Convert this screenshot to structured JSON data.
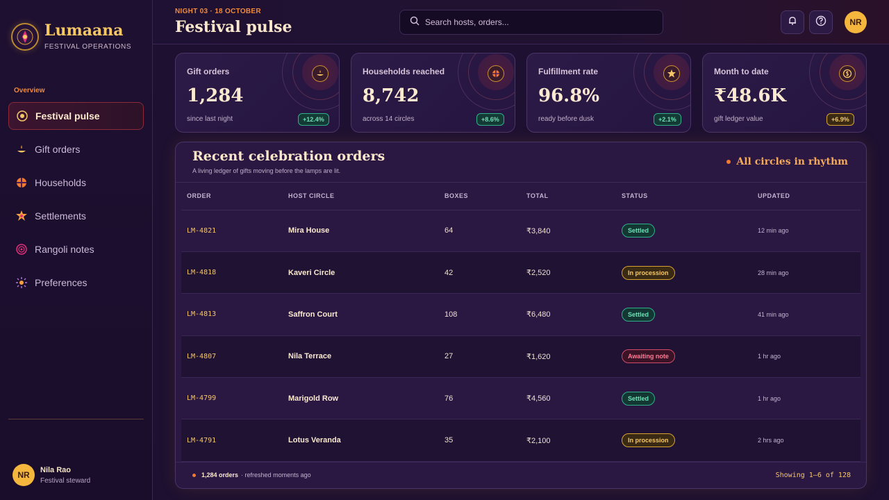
{
  "brand": {
    "name": "Lumaana",
    "subtitle": "FESTIVAL OPERATIONS"
  },
  "sidebar": {
    "section": "Overview",
    "items": [
      {
        "label": "Festival pulse",
        "icon": "pulse-icon",
        "active": true
      },
      {
        "label": "Gift orders",
        "icon": "diya-icon"
      },
      {
        "label": "Households",
        "icon": "household-icon"
      },
      {
        "label": "Settlements",
        "icon": "star-icon"
      },
      {
        "label": "Rangoli notes",
        "icon": "rangoli-icon"
      },
      {
        "label": "Preferences",
        "icon": "sun-icon"
      }
    ],
    "user": {
      "initials": "NR",
      "name": "Nila Rao",
      "role": "Festival steward"
    }
  },
  "header": {
    "eyebrow": "NIGHT 03 · 18 OCTOBER",
    "title": "Festival pulse",
    "search_placeholder": "Search hosts, orders...",
    "avatar_initials": "NR"
  },
  "stats": [
    {
      "label": "Gift orders",
      "value": "1,284",
      "note": "since last night",
      "delta": "+12.4%",
      "tone": "green",
      "icon": "diya-icon"
    },
    {
      "label": "Households reached",
      "value": "8,742",
      "note": "across 14 circles",
      "delta": "+8.6%",
      "tone": "green",
      "icon": "household-icon"
    },
    {
      "label": "Fulfillment rate",
      "value": "96.8%",
      "note": "ready before dusk",
      "delta": "+2.1%",
      "tone": "green",
      "icon": "star-icon"
    },
    {
      "label": "Month to date",
      "value": "₹48.6K",
      "note": "gift ledger value",
      "delta": "+6.9%",
      "tone": "gold",
      "icon": "coin-icon"
    }
  ],
  "orders": {
    "title": "Recent celebration orders",
    "subtitle": "A living ledger of gifts moving before the lamps are lit.",
    "status_line": "All circles in rhythm",
    "columns": [
      "ORDER",
      "HOST CIRCLE",
      "BOXES",
      "TOTAL",
      "STATUS",
      "UPDATED"
    ],
    "rows": [
      {
        "order": "LM-4821",
        "host": "Mira House",
        "boxes": "64",
        "total": "₹3,840",
        "status": "Settled",
        "kind": "settled",
        "updated": "12 min ago"
      },
      {
        "order": "LM-4818",
        "host": "Kaveri Circle",
        "boxes": "42",
        "total": "₹2,520",
        "status": "In procession",
        "kind": "proc",
        "updated": "28 min ago"
      },
      {
        "order": "LM-4813",
        "host": "Saffron Court",
        "boxes": "108",
        "total": "₹6,480",
        "status": "Settled",
        "kind": "settled",
        "updated": "41 min ago"
      },
      {
        "order": "LM-4807",
        "host": "Nila Terrace",
        "boxes": "27",
        "total": "₹1,620",
        "status": "Awaiting note",
        "kind": "await",
        "updated": "1 hr ago"
      },
      {
        "order": "LM-4799",
        "host": "Marigold Row",
        "boxes": "76",
        "total": "₹4,560",
        "status": "Settled",
        "kind": "settled",
        "updated": "1 hr ago"
      },
      {
        "order": "LM-4791",
        "host": "Lotus Veranda",
        "boxes": "35",
        "total": "₹2,100",
        "status": "In procession",
        "kind": "proc",
        "updated": "2 hrs ago"
      }
    ],
    "footer_count": "1,284 orders",
    "footer_note": "· refreshed moments ago",
    "footer_paging": "Showing 1–6 of 128"
  }
}
